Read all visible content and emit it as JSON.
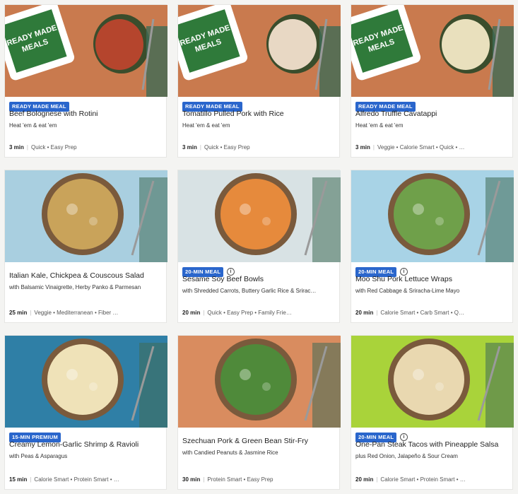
{
  "cards": [
    {
      "badge": "READY MADE MEAL",
      "title": "Beef Bolognese with Rotini",
      "subtitle": "Heat 'em & eat 'em",
      "time": "3 min",
      "tags": "Quick • Easy Prep",
      "image": "beef-bolognese-photo",
      "bg": "#c97a4e",
      "food": "#b5452d"
    },
    {
      "badge": "READY MADE MEAL",
      "title": "Tomatillo Pulled Pork with Rice",
      "subtitle": "Heat 'em & eat 'em",
      "time": "3 min",
      "tags": "Quick • Easy Prep",
      "image": "pulled-pork-photo",
      "bg": "#c97a4e",
      "food": "#e8d8c4"
    },
    {
      "badge": "READY MADE MEAL",
      "title": "Alfredo Truffle Cavatappi",
      "subtitle": "Heat 'em & eat 'em",
      "time": "3 min",
      "tags": "Veggie • Calorie Smart • Quick • …",
      "image": "cavatappi-photo",
      "bg": "#c97a4e",
      "food": "#e9e0bd"
    },
    {
      "badge": "",
      "title": "Italian Kale, Chickpea & Couscous Salad",
      "subtitle": "with Balsamic Vinaigrette, Herby Panko & Parmesan",
      "time": "25 min",
      "tags": "Veggie • Mediterranean • Fiber …",
      "image": "couscous-salad-photo",
      "bg": "#a9cfe0",
      "food": "#c9a35a"
    },
    {
      "badge": "20-MIN MEAL",
      "title": "Sesame Soy Beef Bowls",
      "subtitle": "with Shredded Carrots, Buttery Garlic Rice & Srirac…",
      "time": "20 min",
      "tags": "Quick • Easy Prep • Family Frie…",
      "image": "beef-bowl-photo",
      "bg": "#d8e2e4",
      "food": "#e68a3c"
    },
    {
      "badge": "20-MIN MEAL",
      "title": "Moo Shu Pork Lettuce Wraps",
      "subtitle": "with Red Cabbage & Sriracha-Lime Mayo",
      "time": "20 min",
      "tags": "Calorie Smart • Carb Smart • Q…",
      "image": "lettuce-wraps-photo",
      "bg": "#a8d3e6",
      "food": "#6fa04a"
    },
    {
      "badge": "15-MIN PREMIUM",
      "title": "Creamy Lemon-Garlic Shrimp & Ravioli",
      "subtitle": "with Peas & Asparagus",
      "time": "15 min",
      "tags": "Calorie Smart • Protein Smart • …",
      "image": "shrimp-ravioli-photo",
      "bg": "#2f7fa6",
      "food": "#efe2b8"
    },
    {
      "badge": "",
      "title": "Szechuan Pork & Green Bean Stir-Fry",
      "subtitle": "with Candied Peanuts & Jasmine Rice",
      "time": "30 min",
      "tags": "Protein Smart • Easy Prep",
      "image": "stir-fry-photo",
      "bg": "#d98c5f",
      "food": "#4f8a3a"
    },
    {
      "badge": "20-MIN MEAL",
      "title": "One-Pan Steak Tacos with Pineapple Salsa",
      "subtitle": "plus Red Onion, Jalapeño & Sour Cream",
      "time": "20 min",
      "tags": "Calorie Smart • Protein Smart • …",
      "image": "steak-tacos-photo",
      "bg": "#a9d33a",
      "food": "#e9d8b0"
    }
  ],
  "colors": {
    "badge": "#2a66cc",
    "package_green": "#2f7a3a"
  }
}
